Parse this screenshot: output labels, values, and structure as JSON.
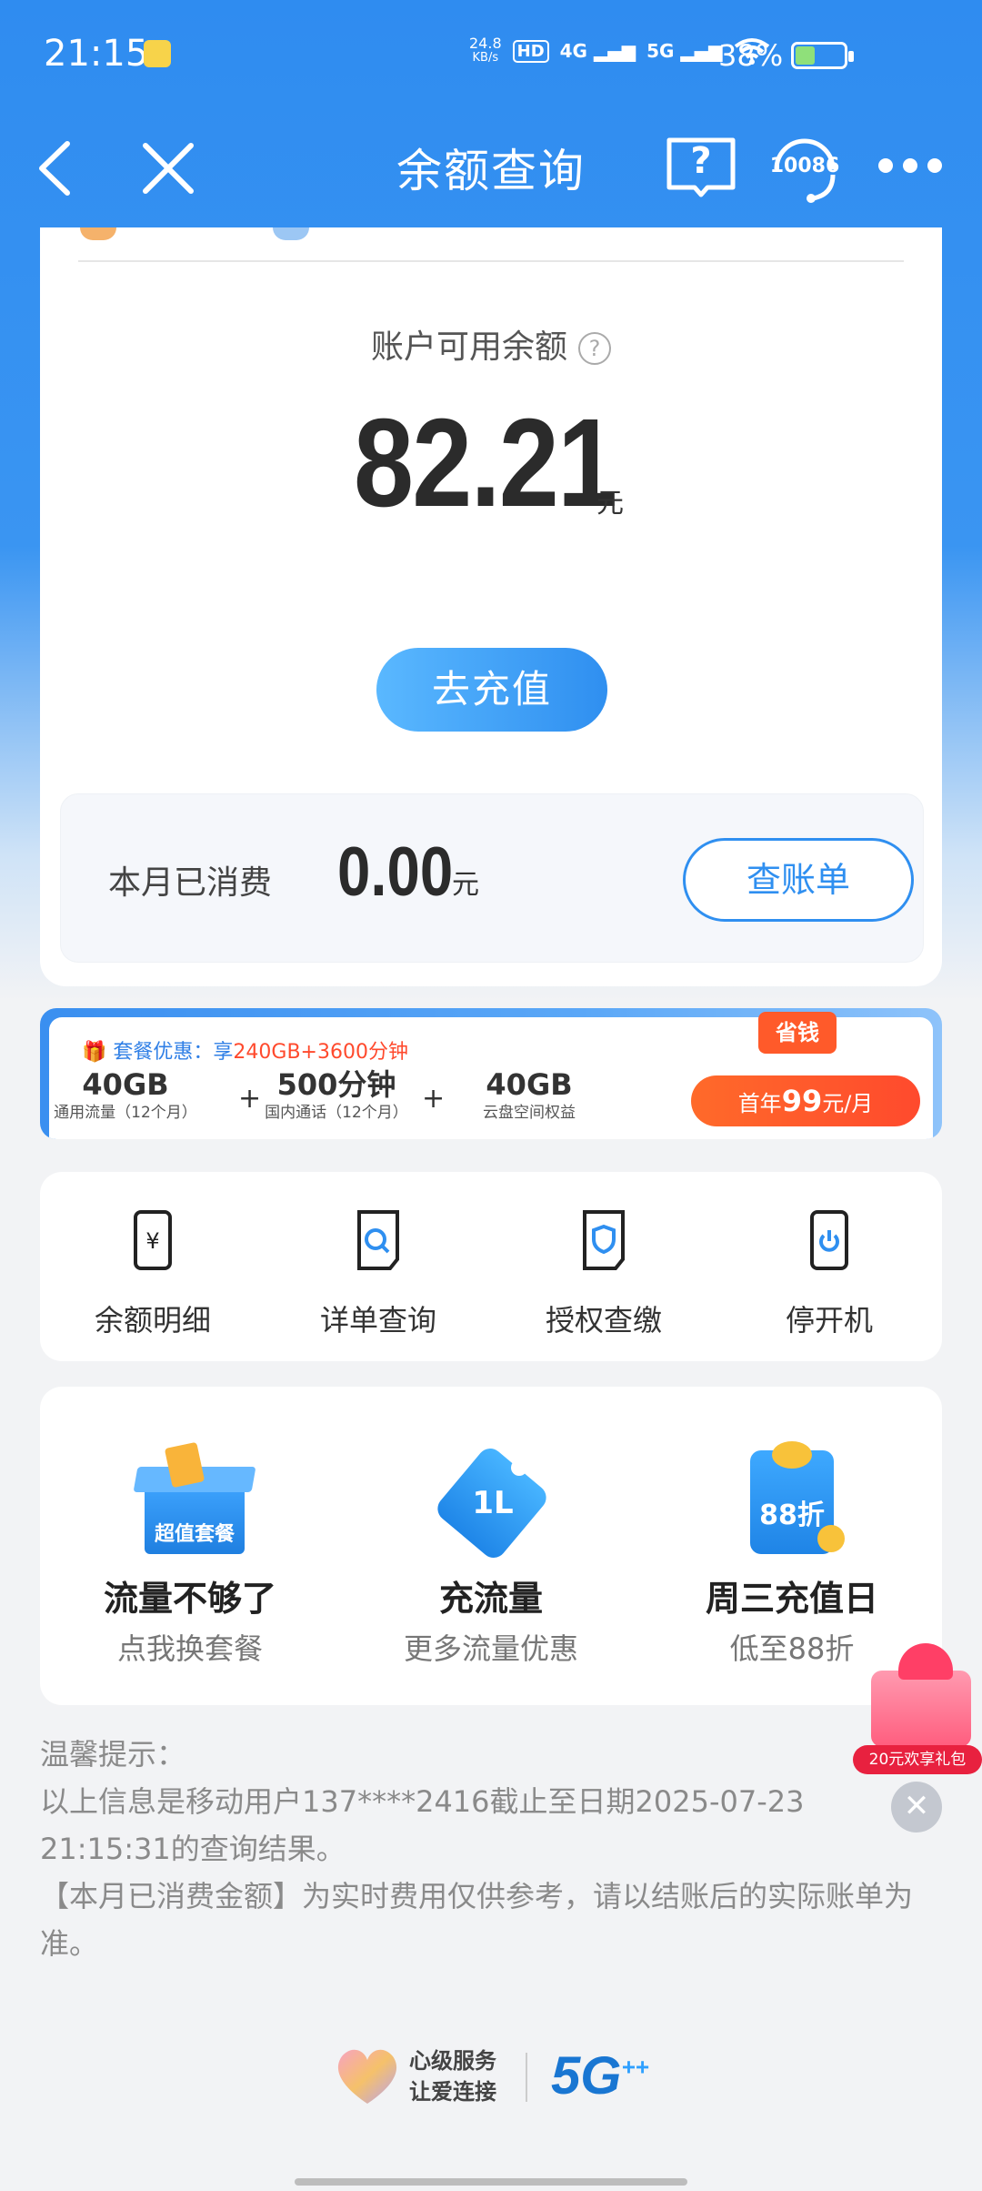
{
  "status_bar": {
    "time": "21:15",
    "net_speed_value": "24.8",
    "net_speed_unit": "KB/s",
    "hd": "HD",
    "sim1": "4G",
    "sim2": "5G",
    "battery_percent": "38%",
    "battery_level": 0.38
  },
  "nav": {
    "title": "余额查询",
    "service_number": "10086",
    "help_glyph": "?"
  },
  "balance": {
    "label": "账户可用余额",
    "amount": "82.21",
    "unit": "元",
    "recharge_label": "去充值",
    "month_label": "本月已消费",
    "month_amount": "0.00",
    "month_unit": "元",
    "bill_label": "查账单"
  },
  "promo": {
    "title_prefix": "套餐优惠：享",
    "title_highlight": "240GB+3600分钟",
    "items": [
      {
        "big": "40GB",
        "small": "通用流量（12个月）"
      },
      {
        "big": "500分钟",
        "small": "国内通话（12个月）"
      },
      {
        "big": "40GB",
        "small": "云盘空间权益"
      }
    ],
    "plus": "+",
    "tag": "省钱",
    "button_prefix": "首年",
    "button_number": "99",
    "button_suffix": "元/月"
  },
  "quick_services": [
    {
      "label": "余额明细",
      "icon": "phone-yuan-icon"
    },
    {
      "label": "详单查询",
      "icon": "search-document-icon"
    },
    {
      "label": "授权查缴",
      "icon": "shield-document-icon"
    },
    {
      "label": "停开机",
      "icon": "phone-power-icon"
    }
  ],
  "features": [
    {
      "title": "流量不够了",
      "subtitle": "点我换套餐",
      "badge": "超值套餐",
      "icon": "package-box-icon"
    },
    {
      "title": "充流量",
      "subtitle": "更多流量优惠",
      "badge": "1L",
      "icon": "data-tag-icon"
    },
    {
      "title": "周三充值日",
      "subtitle": "低至88折",
      "badge": "88折",
      "icon": "discount-envelope-icon"
    }
  ],
  "gift": {
    "label": "20元欢享礼包",
    "close_glyph": "✕"
  },
  "tips": {
    "heading": "温馨提示：",
    "line1": "以上信息是移动用户137****2416截止至日期2025-07-23 21:15:31的查询结果。",
    "line2": "【本月已消费金额】为实时费用仅供参考，请以结账后的实际账单为准。"
  },
  "footer": {
    "slogan1": "心级服务",
    "slogan2": "让爱连接",
    "badge": "5G",
    "badge_sup": "++"
  },
  "colors": {
    "brand_blue": "#2f8ff0",
    "promo_red": "#ff4a2d",
    "battery_green": "#8fe07a"
  }
}
